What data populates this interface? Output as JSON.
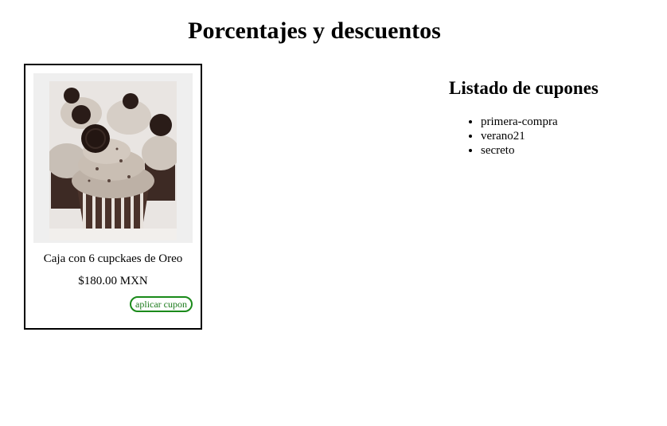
{
  "page": {
    "title": "Porcentajes y descuentos"
  },
  "product": {
    "image_name": "oreo-cupcakes-photo",
    "name": "Caja con 6 cupckaes de Oreo",
    "price": "$180.00 MXN",
    "apply_label": "aplicar cupon"
  },
  "coupons": {
    "title": "Listado de cupones",
    "items": [
      "primera-compra",
      "verano21",
      "secreto"
    ]
  },
  "colors": {
    "button_border": "#1a8a1a",
    "button_text": "#1a7a1a"
  }
}
